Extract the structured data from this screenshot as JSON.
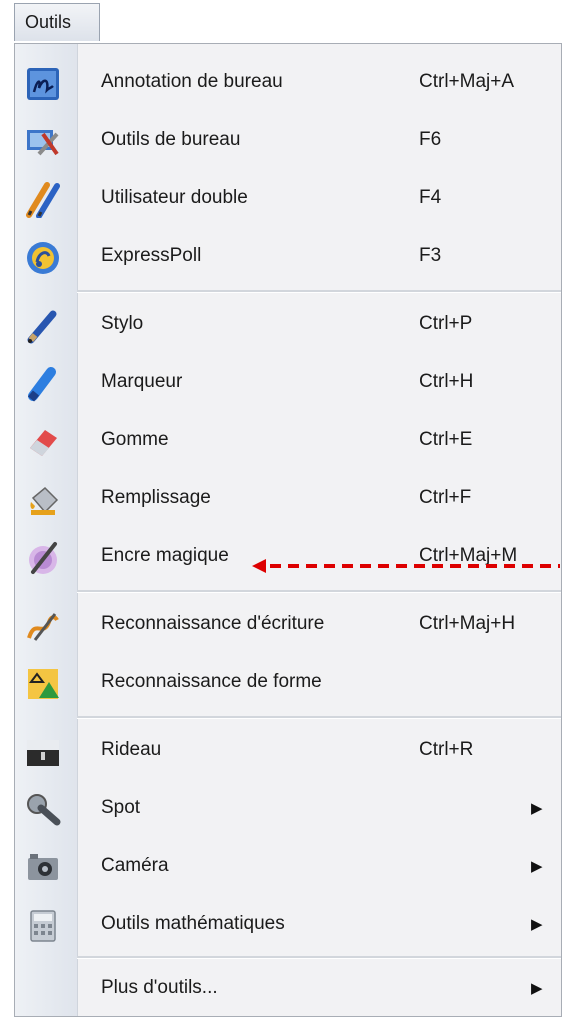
{
  "menu": {
    "title": "Outils"
  },
  "items": [
    {
      "label": "Annotation de bureau",
      "shortcut": "Ctrl+Maj+A",
      "icon": "desktop-annotation-icon"
    },
    {
      "label": "Outils de bureau",
      "shortcut": "F6",
      "icon": "desktop-tools-icon"
    },
    {
      "label": "Utilisateur double",
      "shortcut": "F4",
      "icon": "dual-user-icon"
    },
    {
      "label": "ExpressPoll",
      "shortcut": "F3",
      "icon": "expresspoll-icon"
    },
    {
      "label": "Stylo",
      "shortcut": "Ctrl+P",
      "icon": "pen-icon"
    },
    {
      "label": "Marqueur",
      "shortcut": "Ctrl+H",
      "icon": "highlighter-icon"
    },
    {
      "label": "Gomme",
      "shortcut": "Ctrl+E",
      "icon": "eraser-icon"
    },
    {
      "label": "Remplissage",
      "shortcut": "Ctrl+F",
      "icon": "fill-bucket-icon"
    },
    {
      "label": "Encre magique",
      "shortcut": "Ctrl+Maj+M",
      "icon": "magic-ink-icon"
    },
    {
      "label": "Reconnaissance d'écriture",
      "shortcut": "Ctrl+Maj+H",
      "icon": "handwriting-recognition-icon"
    },
    {
      "label": "Reconnaissance de forme",
      "shortcut": "",
      "icon": "shape-recognition-icon"
    },
    {
      "label": "Rideau",
      "shortcut": "Ctrl+R",
      "icon": "curtain-icon"
    },
    {
      "label": "Spot",
      "shortcut": "",
      "submenu": true,
      "icon": "spotlight-icon"
    },
    {
      "label": "Caméra",
      "shortcut": "",
      "submenu": true,
      "icon": "camera-icon"
    },
    {
      "label": "Outils mathématiques",
      "shortcut": "",
      "submenu": true,
      "icon": "calculator-icon"
    },
    {
      "label": "Plus d'outils...",
      "shortcut": "",
      "submenu": true,
      "icon": "more-tools-icon"
    }
  ],
  "annotation": {
    "color": "#dd0000",
    "points_to": "Encre magique"
  }
}
